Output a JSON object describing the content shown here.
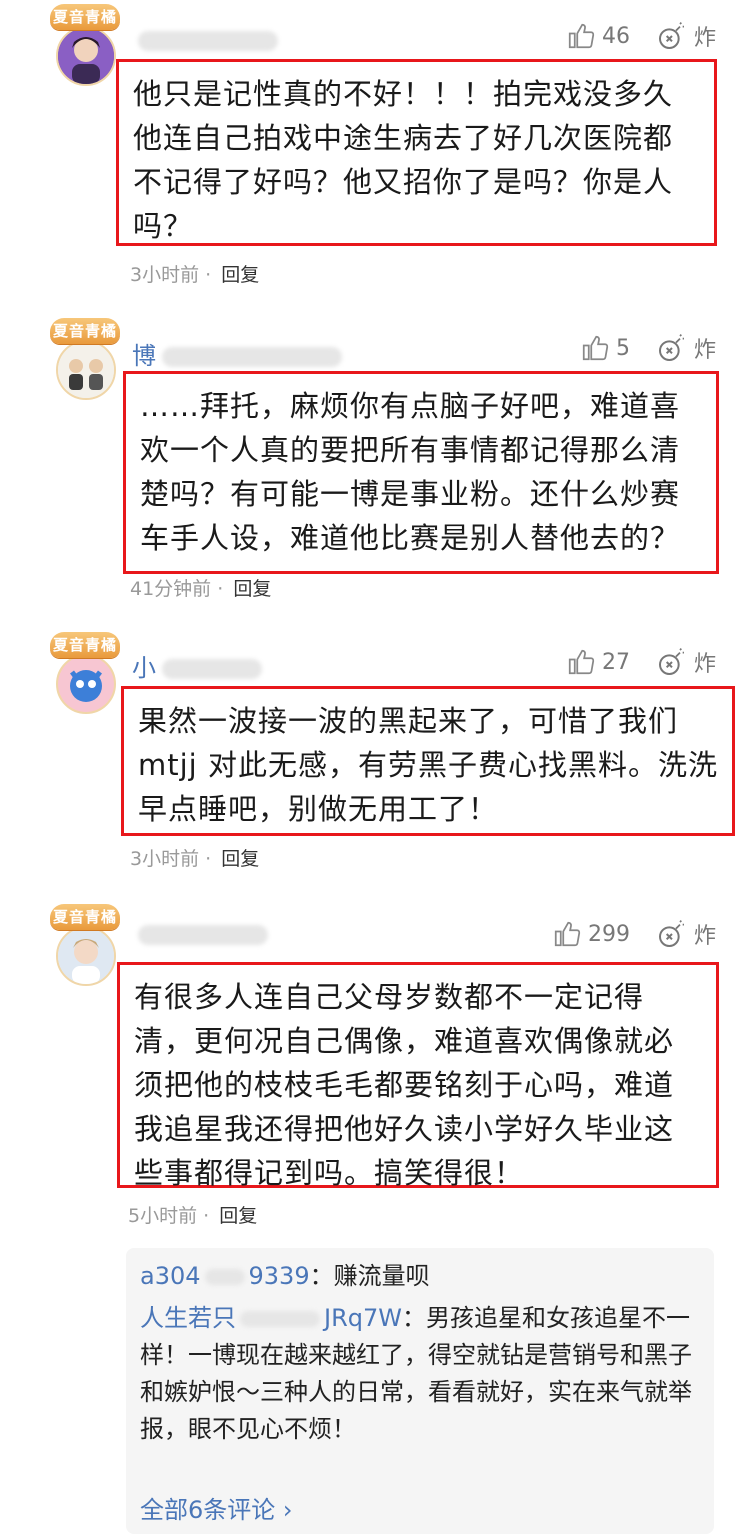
{
  "badge_text": "夏音青橘",
  "like_icon": "thumbs-up-outline",
  "bomb_icon": "bomb-outline",
  "bomb_label": "炸",
  "reply_label": "回复",
  "highlight_color": "#e8171b",
  "comments": [
    {
      "username": "",
      "likes": "46",
      "text": "他只是记性真的不好！！！拍完戏没多久他连自己拍戏中途生病去了好几次医院都不记得了好吗？他又招你了是吗？你是人吗？",
      "time": "3小时前"
    },
    {
      "username": "博",
      "likes": "5",
      "text": "……拜托，麻烦你有点脑子好吧，难道喜欢一个人真的要把所有事情都记得那么清楚吗？有可能一博是事业粉。还什么炒赛车手人设，难道他比赛是别人替他去的？",
      "time": "41分钟前"
    },
    {
      "username": "小",
      "likes": "27",
      "text": "果然一波接一波的黑起来了，可惜了我们mtjj 对此无感，有劳黑子费心找黑料。洗洗早点睡吧，别做无用工了！",
      "time": "3小时前"
    },
    {
      "username": "",
      "likes": "299",
      "text": "有很多人连自己父母岁数都不一定记得清，更何况自己偶像，难道喜欢偶像就必须把他的枝枝毛毛都要铭刻于心吗，难道我追星我还得把他好久读小学好久毕业这些事都得记到吗。搞笑得很！",
      "time": "5小时前"
    }
  ],
  "replies": [
    {
      "user": "a304",
      "user_tail": "9339",
      "text": "：赚流量呗"
    },
    {
      "user": "人生若只",
      "user_tail": "JRq7W",
      "text": "：男孩追星和女孩追星不一样！一博现在越来越红了，得空就钻是营销号和黑子和嫉妒恨～三种人的日常，看看就好，实在来气就举报，眼不见心不烦！"
    }
  ],
  "more_comments": "全部6条评论 ›"
}
